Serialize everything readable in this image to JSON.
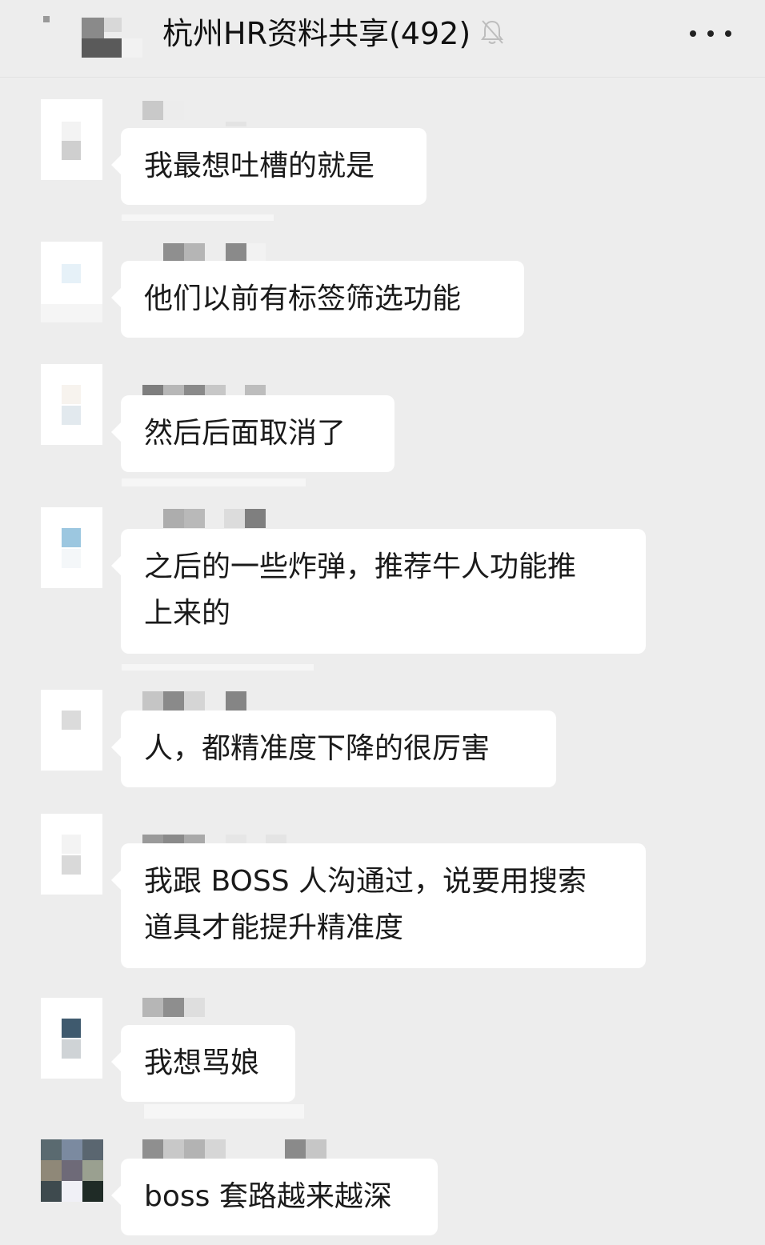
{
  "header": {
    "title": "杭州HR资料共享(492)",
    "mute_icon": "bell-off-icon",
    "more_icon": "more-dots-icon",
    "back_icon": "back-arrow-icon"
  },
  "messages": [
    {
      "text": "我最想吐槽的就是"
    },
    {
      "text": "他们以前有标签筛选功能"
    },
    {
      "text": "然后后面取消了"
    },
    {
      "line1": "之后的一些炸弹，推荐牛人功能推",
      "line2": "上来的"
    },
    {
      "text": "人，都精准度下降的很厉害"
    },
    {
      "line1": "我跟 BOSS 人沟通过，说要用搜索",
      "line2": "道具才能提升精准度"
    },
    {
      "text": "我想骂娘"
    },
    {
      "text": "boss 套路越来越深"
    }
  ],
  "colors": {
    "background": "#ededed",
    "bubble": "#ffffff",
    "text": "#1a1a1a"
  }
}
